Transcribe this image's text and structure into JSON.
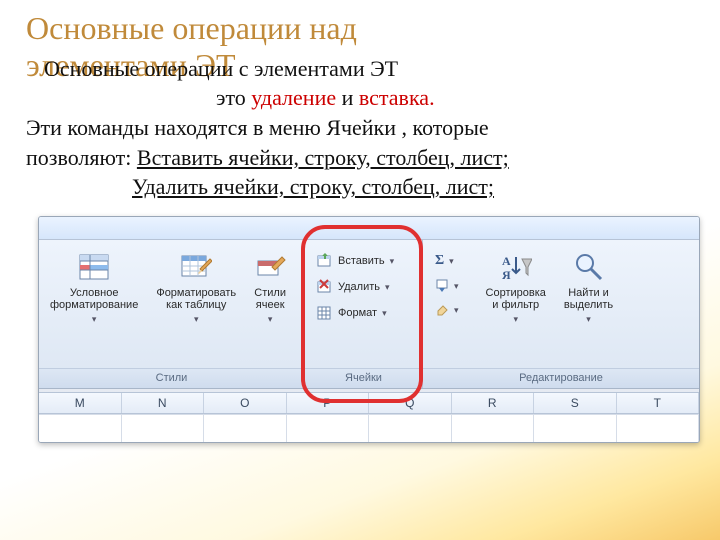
{
  "title_line1": "Основные операции над",
  "title_line2": "элементами ЭТ",
  "para": {
    "a": "Основные операции  с элементами ЭТ",
    "b_prefix": "это ",
    "b_del": "удаление",
    "b_mid": "  и ",
    "b_ins": "вставка.",
    "c": "Эти команды  находятся  в  меню  Ячейки , которые",
    "d_prefix": "позволяют: ",
    "d_u": "Вставить ячейки, строку, столбец, лист;",
    "e_u": "Удалить ячейки, строку, столбец, лист;"
  },
  "ribbon": {
    "styles": {
      "cond": "Условное\nформатирование",
      "table": "Форматировать\nкак таблицу",
      "cell": "Стили\nячеек",
      "label": "Стили"
    },
    "cells": {
      "insert": "Вставить",
      "delete": "Удалить",
      "format": "Формат",
      "label": "Ячейки"
    },
    "edit": {
      "sort": "Сортировка\nи фильтр",
      "find": "Найти и\nвыделить",
      "label": "Редактирование"
    }
  },
  "columns": [
    "M",
    "N",
    "O",
    "P",
    "Q",
    "R",
    "S",
    "T"
  ]
}
